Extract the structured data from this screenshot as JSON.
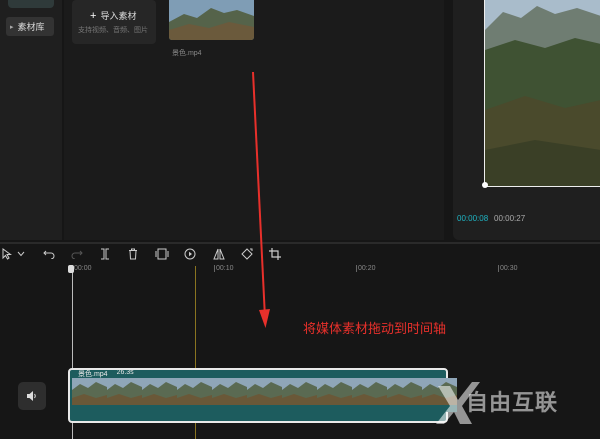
{
  "sidebar": {
    "library_label": "素材库",
    "arrow": "▸"
  },
  "media": {
    "import_label": "导入素材",
    "import_plus": "+",
    "import_hint": "支持视频、音频、图片",
    "thumb_name": "景色.mp4"
  },
  "preview": {
    "current_time": "00:00:08",
    "total_time": "00:00:27"
  },
  "toolbar": {
    "icons": [
      "cursor-icon",
      "undo-icon",
      "redo-icon",
      "split-icon",
      "delete-icon",
      "freeze-icon",
      "play-icon",
      "mirror-icon",
      "rotate-icon",
      "crop-icon"
    ]
  },
  "ruler": {
    "labels": [
      "00:00",
      "00:10",
      "00:20",
      "00:30"
    ]
  },
  "annotation": {
    "text": "将媒体素材拖动到时间轴"
  },
  "clip": {
    "name": "景色.mp4",
    "duration": "26.3s"
  },
  "watermark": {
    "text": "自由互联"
  },
  "colors": {
    "accent": "#1fb5c4",
    "annotation": "#e8302b",
    "clip": "#1d5c5e"
  }
}
